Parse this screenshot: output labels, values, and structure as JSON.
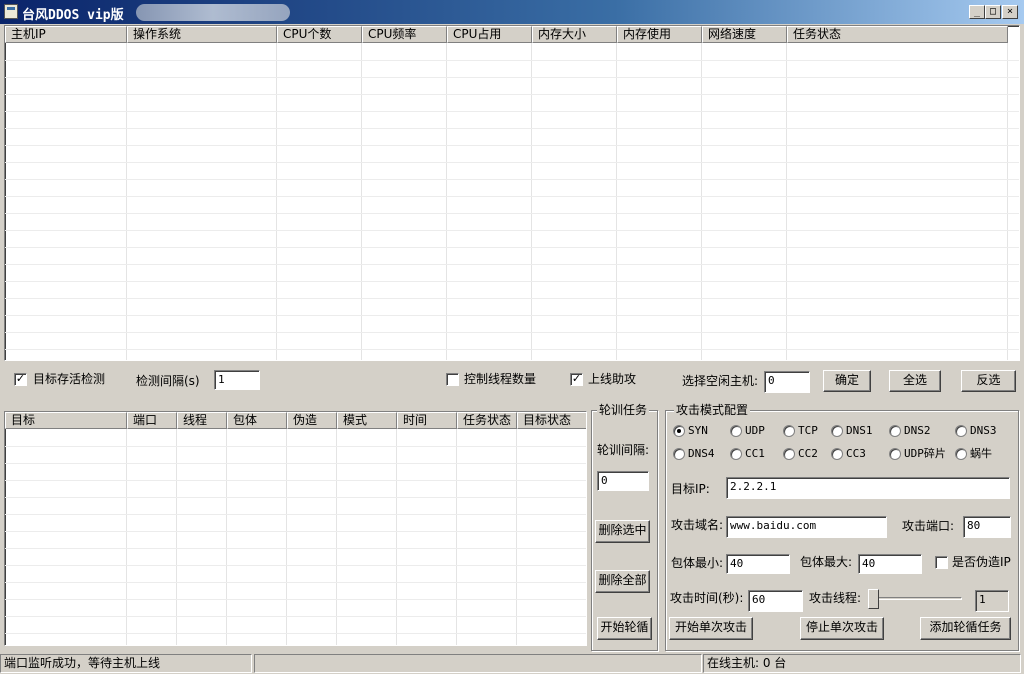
{
  "window": {
    "title": "台风DDOS vip版",
    "min_glyph": "_",
    "max_glyph": "□",
    "close_glyph": "×"
  },
  "host_table": {
    "columns": [
      "主机IP",
      "操作系统",
      "CPU个数",
      "CPU频率",
      "CPU占用",
      "内存大小",
      "内存使用",
      "网络速度",
      "任务状态"
    ],
    "rows": []
  },
  "options": {
    "alive_check": {
      "label": "目标存活检测",
      "checked": true
    },
    "interval_label": "检测间隔(s)",
    "interval_value": "1",
    "thread_control": {
      "label": "控制线程数量",
      "checked": false
    },
    "online_assist": {
      "label": "上线助攻",
      "checked": true
    },
    "idle_host_label": "选择空闲主机:",
    "idle_host_value": "0",
    "confirm": "确定",
    "select_all": "全选",
    "invert": "反选"
  },
  "task_table": {
    "columns": [
      "目标",
      "端口",
      "线程",
      "包体",
      "伪造",
      "模式",
      "时间",
      "任务状态",
      "目标状态"
    ],
    "rows": []
  },
  "rotation": {
    "title": "轮训任务",
    "interval_label": "轮训间隔:",
    "interval_value": "0",
    "delete_selected": "删除选中",
    "delete_all": "删除全部",
    "start": "开始轮循"
  },
  "attack": {
    "title": "攻击模式配置",
    "modes_row1": [
      "SYN",
      "UDP",
      "TCP",
      "DNS1",
      "DNS2",
      "DNS3"
    ],
    "modes_row2": [
      "DNS4",
      "CC1",
      "CC2",
      "CC3",
      "UDP碎片",
      "蜗牛"
    ],
    "selected_mode": "SYN",
    "target_ip_label": "目标IP:",
    "target_ip": "2.2.2.1",
    "domain_label": "攻击域名:",
    "domain": "www.baidu.com",
    "port_label": "攻击端口:",
    "port": "80",
    "pkt_min_label": "包体最小:",
    "pkt_min": "40",
    "pkt_max_label": "包体最大:",
    "pkt_max": "40",
    "spoof_label": "是否伪造IP",
    "spoof_checked": false,
    "time_label": "攻击时间(秒):",
    "time": "60",
    "threads_label": "攻击线程:",
    "threads": "1",
    "threads_level": 0,
    "start_single": "开始单次攻击",
    "stop_single": "停止单次攻击",
    "add_rotation": "添加轮循任务"
  },
  "status": {
    "message": "端口监听成功，等待主机上线",
    "online": "在线主机: 0 台"
  }
}
